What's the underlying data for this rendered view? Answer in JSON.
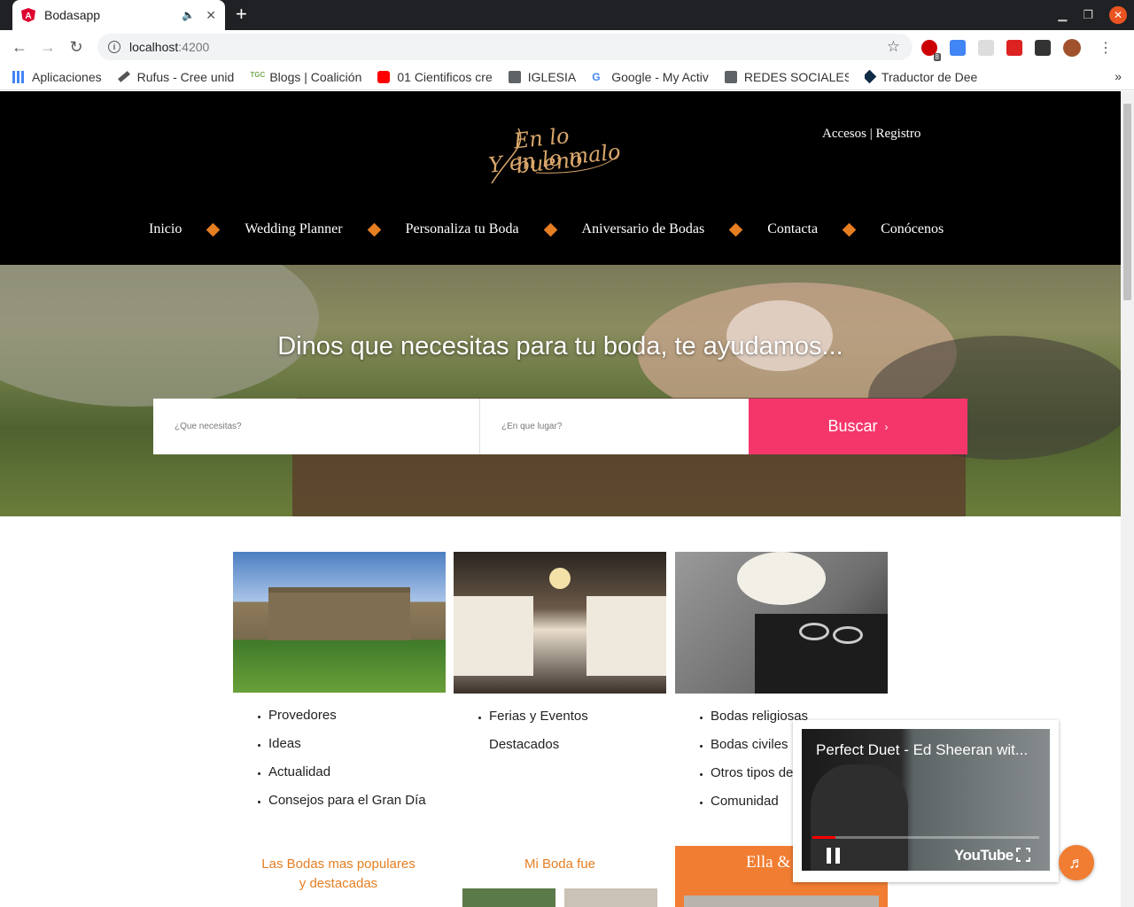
{
  "browser": {
    "tab_title": "Bodasapp",
    "url_host": "localhost",
    "url_port": ":4200",
    "extension_badge": "8",
    "bookmarks": [
      {
        "label": "Aplicaciones",
        "icon": "apps-grid-icon"
      },
      {
        "label": "Rufus - Cree unid",
        "icon": "rufus-icon"
      },
      {
        "label": "Blogs | Coalición",
        "icon": "tgc-icon"
      },
      {
        "label": "01 Cientificos cre",
        "icon": "youtube-icon"
      },
      {
        "label": "IGLESIA",
        "icon": "folder-icon"
      },
      {
        "label": "Google - My Activ",
        "icon": "google-icon"
      },
      {
        "label": "REDES SOCIALES",
        "icon": "folder-icon"
      },
      {
        "label": "Traductor de Dee",
        "icon": "deepl-icon"
      }
    ],
    "bookmarks_overflow": "»"
  },
  "site": {
    "logo_line1": "En lo bueno",
    "logo_line2": "Y en lo malo",
    "auth_links": "Accesos | Registro",
    "nav": [
      "Inicio",
      "Wedding Planner",
      "Personaliza tu Boda",
      "Aniversario de Bodas",
      "Contacta",
      "Conócenos"
    ],
    "accent_color": "#e67e22",
    "hero": {
      "title": "Dinos que necesitas para tu boda, te ayudamos...",
      "what_placeholder": "¿Que necesitas?",
      "where_placeholder": "¿En que lugar?",
      "search_button": "Buscar",
      "search_button_arrow": "›",
      "button_color": "#f5366b"
    },
    "cards": [
      {
        "items": [
          "Provedores",
          "Ideas",
          "Actualidad",
          "Consejos para el Gran Día"
        ]
      },
      {
        "items": [
          "Ferias y Eventos",
          "Destacados"
        ]
      },
      {
        "items": [
          "Bodas religiosas",
          "Bodas civiles",
          "Otros tipos de",
          "Comunidad"
        ]
      }
    ],
    "section_popular": "Las Bodas mas populares y destacadas",
    "section_my_wedding": "Mi Boda fue",
    "section_ella": "Ella &"
  },
  "player": {
    "video_title": "Perfect Duet - Ed Sheeran wit...",
    "brand": "YouTube",
    "progress": 0.1
  }
}
